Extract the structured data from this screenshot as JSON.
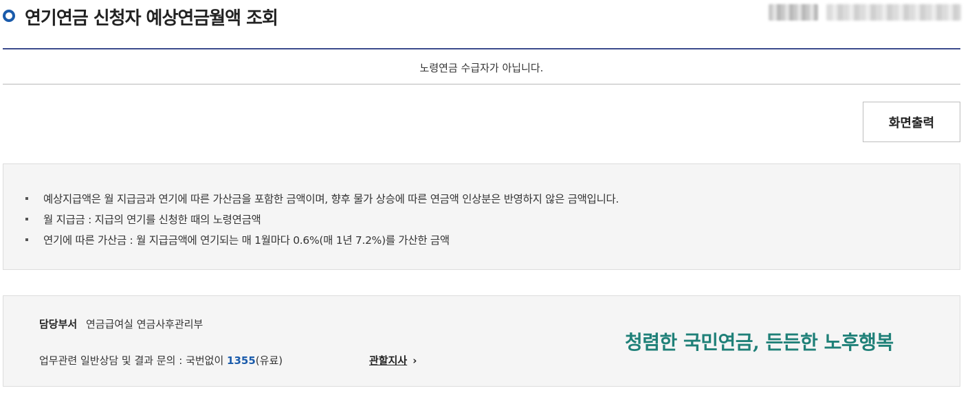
{
  "header": {
    "title": "연기연금 신청자 예상연금월액 조회",
    "accent_color": "#1a5bab"
  },
  "result": {
    "message": "노령연금 수급자가 아닙니다."
  },
  "actions": {
    "print_label": "화면출력"
  },
  "notice": {
    "items": [
      "예상지급액은 월 지급금과 연기에 따른 가산금을 포함한 금액이며, 향후 물가 상승에 따른 연금액 인상분은 반영하지 않은 금액입니다.",
      "월 지급금 : 지급의 연기를 신청한 때의 노령연금액",
      "연기에 따른 가산금 : 월 지급금액에 연기되는 매 1월마다 0.6%(매 1년 7.2%)를 가산한 금액"
    ]
  },
  "footer": {
    "dept_label": "담당부서",
    "dept_value": "연금급여실 연금사후관리부",
    "contact_prefix": "업무관련 일반상담 및 결과 문의 : 국번없이",
    "contact_number": "1355",
    "contact_suffix": "(유료)",
    "branch_link": "관할지사",
    "slogan": "청렴한 국민연금, 든든한 노후행복",
    "slogan_color": "#1f8078"
  },
  "icons": {
    "title_bullet": "circle-bullet-icon",
    "branch_chevron": "chevron-right-icon"
  }
}
